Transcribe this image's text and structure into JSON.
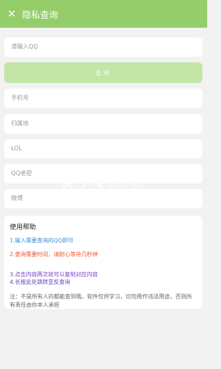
{
  "header": {
    "close_icon_glyph": "✕",
    "title": "隐私查询"
  },
  "form": {
    "qq_placeholder": "请输入QQ",
    "query_label": "查询",
    "phone_placeholder": "手机号",
    "location_placeholder": "归属地",
    "lol_placeholder": "LOL",
    "qq_password_placeholder": "QQ老密",
    "weibo_placeholder": "微博"
  },
  "help": {
    "title": "使用帮助",
    "items": [
      "1.输入需要查询的QQ即可",
      "2.查询需要时间，请耐心等待几秒钟",
      "3.点击内容两次就可以复制对应内容",
      "4.长按此处跳转至反查询"
    ],
    "note": "注：不是所有人的都能查到哦。软件仅供学习，切勿用作违法用途，否则所有责任由你本人承担"
  },
  "watermark": {
    "logo": "K73",
    "text": "游戏之家"
  },
  "colors": {
    "brand": "#94cd6a",
    "button_disabled": "#c3e6a7",
    "background": "#f2f2f2"
  }
}
